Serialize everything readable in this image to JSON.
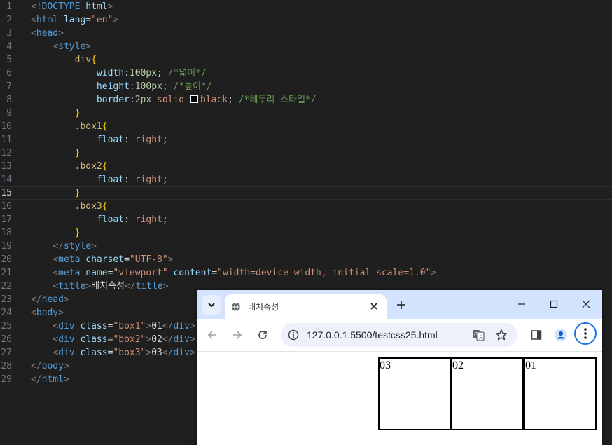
{
  "editor": {
    "active_line": 15,
    "lines": [
      {
        "n": 1,
        "tokens": [
          [
            "c-pun",
            "<"
          ],
          [
            "c-tag",
            "!DOCTYPE"
          ],
          [
            "c-txt",
            " "
          ],
          [
            "c-attr",
            "html"
          ],
          [
            "c-pun",
            ">"
          ]
        ]
      },
      {
        "n": 2,
        "tokens": [
          [
            "c-pun",
            "<"
          ],
          [
            "c-tag",
            "html"
          ],
          [
            "c-txt",
            " "
          ],
          [
            "c-attr",
            "lang"
          ],
          [
            "c-txt",
            "="
          ],
          [
            "c-str",
            "\"en\""
          ],
          [
            "c-pun",
            ">"
          ]
        ]
      },
      {
        "n": 3,
        "tokens": [
          [
            "c-pun",
            "<"
          ],
          [
            "c-tag",
            "head"
          ],
          [
            "c-pun",
            ">"
          ]
        ]
      },
      {
        "n": 4,
        "tokens": [
          [
            "c-txt",
            "    "
          ],
          [
            "c-pun",
            "<"
          ],
          [
            "c-tag",
            "style"
          ],
          [
            "c-pun",
            ">"
          ]
        ]
      },
      {
        "n": 5,
        "tokens": [
          [
            "c-txt",
            "        "
          ],
          [
            "c-sel",
            "div"
          ],
          [
            "c-br",
            "{"
          ]
        ]
      },
      {
        "n": 6,
        "tokens": [
          [
            "c-txt",
            "            "
          ],
          [
            "c-prop",
            "width"
          ],
          [
            "c-txt",
            ":"
          ],
          [
            "c-num",
            "100px"
          ],
          [
            "c-txt",
            "; "
          ],
          [
            "c-com",
            "/*넓이*/"
          ]
        ]
      },
      {
        "n": 7,
        "tokens": [
          [
            "c-txt",
            "            "
          ],
          [
            "c-prop",
            "height"
          ],
          [
            "c-txt",
            ":"
          ],
          [
            "c-num",
            "100px"
          ],
          [
            "c-txt",
            "; "
          ],
          [
            "c-com",
            "/*높이*/"
          ]
        ]
      },
      {
        "n": 8,
        "tokens": [
          [
            "c-txt",
            "            "
          ],
          [
            "c-prop",
            "border"
          ],
          [
            "c-txt",
            ":"
          ],
          [
            "c-num",
            "2px"
          ],
          [
            "c-txt",
            " "
          ],
          [
            "c-val",
            "solid"
          ],
          [
            "c-txt",
            " "
          ],
          [
            "swatch",
            ""
          ],
          [
            "c-val",
            "black"
          ],
          [
            "c-txt",
            "; "
          ],
          [
            "c-com",
            "/*테두리 스타일*/"
          ]
        ]
      },
      {
        "n": 9,
        "tokens": [
          [
            "c-txt",
            "        "
          ],
          [
            "c-br",
            "}"
          ]
        ]
      },
      {
        "n": 10,
        "tokens": [
          [
            "c-txt",
            "        "
          ],
          [
            "c-sel",
            ".box1"
          ],
          [
            "c-br",
            "{"
          ]
        ]
      },
      {
        "n": 11,
        "tokens": [
          [
            "c-txt",
            "            "
          ],
          [
            "c-prop",
            "float"
          ],
          [
            "c-txt",
            ": "
          ],
          [
            "c-val",
            "right"
          ],
          [
            "c-txt",
            ";"
          ]
        ]
      },
      {
        "n": 12,
        "tokens": [
          [
            "c-txt",
            "        "
          ],
          [
            "c-br",
            "}"
          ]
        ]
      },
      {
        "n": 13,
        "tokens": [
          [
            "c-txt",
            "        "
          ],
          [
            "c-sel",
            ".box2"
          ],
          [
            "c-br",
            "{"
          ]
        ]
      },
      {
        "n": 14,
        "tokens": [
          [
            "c-txt",
            "            "
          ],
          [
            "c-prop",
            "float"
          ],
          [
            "c-txt",
            ": "
          ],
          [
            "c-val",
            "right"
          ],
          [
            "c-txt",
            ";"
          ]
        ]
      },
      {
        "n": 15,
        "tokens": [
          [
            "c-txt",
            "        "
          ],
          [
            "c-br",
            "}"
          ]
        ]
      },
      {
        "n": 16,
        "tokens": [
          [
            "c-txt",
            "        "
          ],
          [
            "c-sel",
            ".box3"
          ],
          [
            "c-br",
            "{"
          ]
        ]
      },
      {
        "n": 17,
        "tokens": [
          [
            "c-txt",
            "            "
          ],
          [
            "c-prop",
            "float"
          ],
          [
            "c-txt",
            ": "
          ],
          [
            "c-val",
            "right"
          ],
          [
            "c-txt",
            ";"
          ]
        ]
      },
      {
        "n": 18,
        "tokens": [
          [
            "c-txt",
            "        "
          ],
          [
            "c-br",
            "}"
          ]
        ]
      },
      {
        "n": 19,
        "tokens": [
          [
            "c-txt",
            "    "
          ],
          [
            "c-pun",
            "</"
          ],
          [
            "c-tag",
            "style"
          ],
          [
            "c-pun",
            ">"
          ]
        ]
      },
      {
        "n": 20,
        "tokens": [
          [
            "c-txt",
            "    "
          ],
          [
            "c-pun",
            "<"
          ],
          [
            "c-tag",
            "meta"
          ],
          [
            "c-txt",
            " "
          ],
          [
            "c-attr",
            "charset"
          ],
          [
            "c-txt",
            "="
          ],
          [
            "c-str",
            "\"UTF-8\""
          ],
          [
            "c-pun",
            ">"
          ]
        ]
      },
      {
        "n": 21,
        "tokens": [
          [
            "c-txt",
            "    "
          ],
          [
            "c-pun",
            "<"
          ],
          [
            "c-tag",
            "meta"
          ],
          [
            "c-txt",
            " "
          ],
          [
            "c-attr",
            "name"
          ],
          [
            "c-txt",
            "="
          ],
          [
            "c-str",
            "\"viewport\""
          ],
          [
            "c-txt",
            " "
          ],
          [
            "c-attr",
            "content"
          ],
          [
            "c-txt",
            "="
          ],
          [
            "c-str",
            "\"width=device-width, initial-scale=1.0\""
          ],
          [
            "c-pun",
            ">"
          ]
        ]
      },
      {
        "n": 22,
        "tokens": [
          [
            "c-txt",
            "    "
          ],
          [
            "c-pun",
            "<"
          ],
          [
            "c-tag",
            "title"
          ],
          [
            "c-pun",
            ">"
          ],
          [
            "c-txt",
            "배치속성"
          ],
          [
            "c-pun",
            "</"
          ],
          [
            "c-tag",
            "title"
          ],
          [
            "c-pun",
            ">"
          ]
        ]
      },
      {
        "n": 23,
        "tokens": [
          [
            "c-pun",
            "</"
          ],
          [
            "c-tag",
            "head"
          ],
          [
            "c-pun",
            ">"
          ]
        ]
      },
      {
        "n": 24,
        "tokens": [
          [
            "c-pun",
            "<"
          ],
          [
            "c-tag",
            "body"
          ],
          [
            "c-pun",
            ">"
          ]
        ]
      },
      {
        "n": 25,
        "tokens": [
          [
            "c-txt",
            "    "
          ],
          [
            "c-pun",
            "<"
          ],
          [
            "c-tag",
            "div"
          ],
          [
            "c-txt",
            " "
          ],
          [
            "c-attr",
            "class"
          ],
          [
            "c-txt",
            "="
          ],
          [
            "c-str",
            "\"box1\""
          ],
          [
            "c-pun",
            ">"
          ],
          [
            "c-txt",
            "01"
          ],
          [
            "c-pun",
            "</"
          ],
          [
            "c-tag",
            "div"
          ],
          [
            "c-pun",
            ">"
          ]
        ]
      },
      {
        "n": 26,
        "tokens": [
          [
            "c-txt",
            "    "
          ],
          [
            "c-pun",
            "<"
          ],
          [
            "c-tag",
            "div"
          ],
          [
            "c-txt",
            " "
          ],
          [
            "c-attr",
            "class"
          ],
          [
            "c-txt",
            "="
          ],
          [
            "c-str",
            "\"box2\""
          ],
          [
            "c-pun",
            ">"
          ],
          [
            "c-txt",
            "02"
          ],
          [
            "c-pun",
            "</"
          ],
          [
            "c-tag",
            "div"
          ],
          [
            "c-pun",
            ">"
          ]
        ]
      },
      {
        "n": 27,
        "tokens": [
          [
            "c-txt",
            "    "
          ],
          [
            "c-pun",
            "<"
          ],
          [
            "c-tag",
            "div"
          ],
          [
            "c-txt",
            " "
          ],
          [
            "c-attr",
            "class"
          ],
          [
            "c-txt",
            "="
          ],
          [
            "c-str",
            "\"box3\""
          ],
          [
            "c-pun",
            ">"
          ],
          [
            "c-txt",
            "03"
          ],
          [
            "c-pun",
            "</"
          ],
          [
            "c-tag",
            "div"
          ],
          [
            "c-pun",
            ">"
          ]
        ]
      },
      {
        "n": 28,
        "tokens": [
          [
            "c-pun",
            "</"
          ],
          [
            "c-tag",
            "body"
          ],
          [
            "c-pun",
            ">"
          ]
        ]
      },
      {
        "n": 29,
        "tokens": [
          [
            "c-pun",
            "</"
          ],
          [
            "c-tag",
            "html"
          ],
          [
            "c-pun",
            ">"
          ]
        ]
      }
    ]
  },
  "browser": {
    "tab_title": "배치속성",
    "url": "127.0.0.1:5500/testcss25.html",
    "icons": {
      "tab_search": "chevron-down-icon",
      "favicon": "globe-icon",
      "tab_close": "close-icon",
      "new_tab": "plus-icon",
      "minimize": "minimize-icon",
      "maximize": "maximize-icon",
      "close": "close-icon",
      "back": "arrow-left-icon",
      "forward": "arrow-right-icon",
      "reload": "reload-icon",
      "site_info": "info-icon",
      "translate": "translate-icon",
      "bookmark": "star-icon",
      "side_panel": "side-panel-icon",
      "profile": "profile-icon",
      "menu": "more-vertical-icon"
    },
    "page": {
      "boxes": [
        {
          "class": "box3",
          "text": "03"
        },
        {
          "class": "box2",
          "text": "02"
        },
        {
          "class": "box1",
          "text": "01"
        }
      ]
    }
  }
}
